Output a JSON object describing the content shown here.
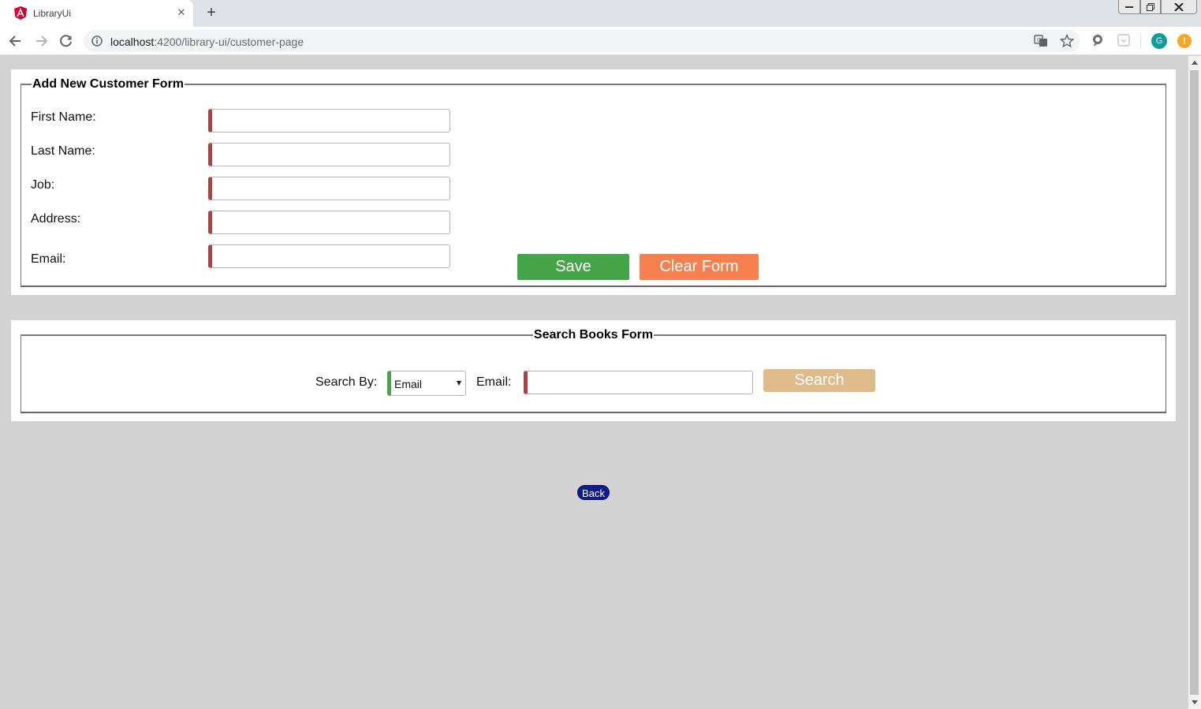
{
  "browser": {
    "tab_title": "LibraryUi",
    "url_host": "localhost",
    "url_path": ":4200/library-ui/customer-page",
    "avatar_letter": "G",
    "alert_glyph": "!"
  },
  "add_form": {
    "legend": "Add New Customer Form",
    "fields": [
      {
        "label": "First Name:",
        "value": ""
      },
      {
        "label": "Last Name:",
        "value": ""
      },
      {
        "label": "Job:",
        "value": ""
      },
      {
        "label": "Address:",
        "value": ""
      },
      {
        "label": "Email:",
        "value": ""
      }
    ],
    "save_label": "Save",
    "clear_label": "Clear Form"
  },
  "search_form": {
    "legend": "Search Books Form",
    "search_by_label": "Search By:",
    "search_by_selected": "Email",
    "field_label": "Email:",
    "field_value": "",
    "search_label": "Search"
  },
  "back_label": "Back",
  "colors": {
    "save": "#43a547",
    "clear": "#f6804f",
    "search": "#dfbb8b",
    "back": "#111b8a",
    "invalid_marker": "#a94442",
    "valid_marker": "#43a547",
    "page_bg": "#d3d3d3"
  }
}
